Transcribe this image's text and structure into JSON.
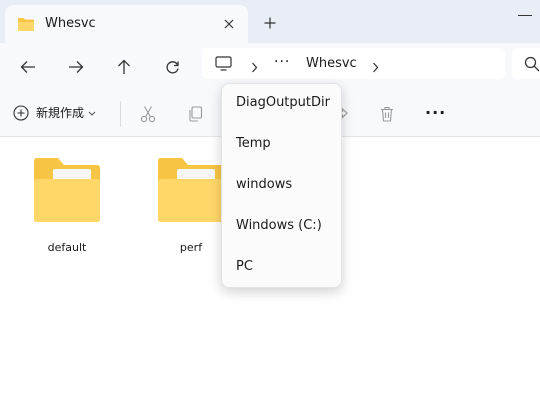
{
  "tab": {
    "title": "Whesvc"
  },
  "address": {
    "overflow_label": "···",
    "crumb": "Whesvc"
  },
  "toolbar": {
    "new_label": "新規作成",
    "more_label": "···"
  },
  "files": [
    {
      "name": "default"
    },
    {
      "name": "perf"
    }
  ],
  "dropdown": {
    "items": [
      "DiagOutputDir",
      "Temp",
      "windows",
      "Windows (C:)",
      "PC"
    ]
  },
  "colors": {
    "titlebar_bg": "#e9eef6",
    "toolbar_bg": "#f7f9fc",
    "folder_yellow": "#f8c443",
    "folder_front": "#ffd768",
    "disabled_icon": "#9a9a9a"
  }
}
